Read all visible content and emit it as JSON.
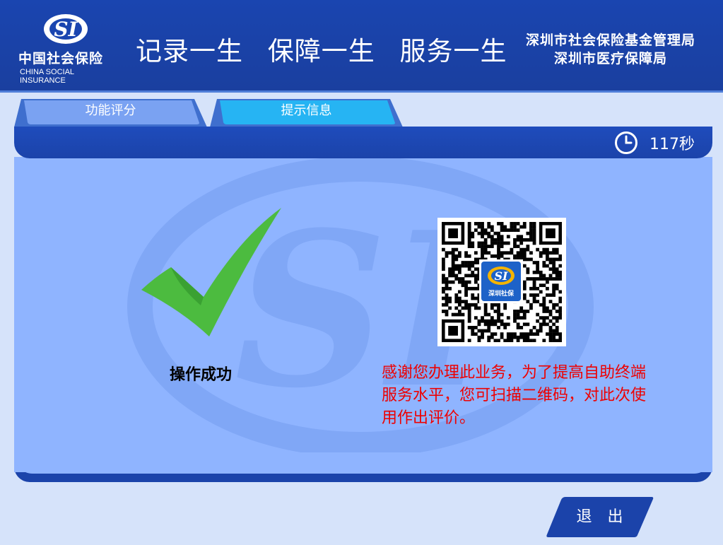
{
  "header": {
    "logo_cn": "中国社会保险",
    "logo_en": "CHINA SOCIAL INSURANCE",
    "slogan": [
      "记录一生",
      "保障一生",
      "服务一生"
    ],
    "org_line1": "深圳市社会保险基金管理局",
    "org_line2": "深圳市医疗保障局"
  },
  "tabs": [
    {
      "label": "功能评分"
    },
    {
      "label": "提示信息"
    }
  ],
  "timer": {
    "text": "117秒"
  },
  "content": {
    "success_text": "操作成功",
    "message": "感谢您办理此业务，为了提高自助终端服务水平，您可扫描二维码，对此次使用作出评价。",
    "qr_badge_label": "深圳社保"
  },
  "buttons": {
    "exit_label": "退　出"
  },
  "colors": {
    "header_blue": "#1a45b0",
    "panel_blue": "#8fb4ff",
    "check_green": "#4cbb3f",
    "message_red": "#ee0000"
  }
}
